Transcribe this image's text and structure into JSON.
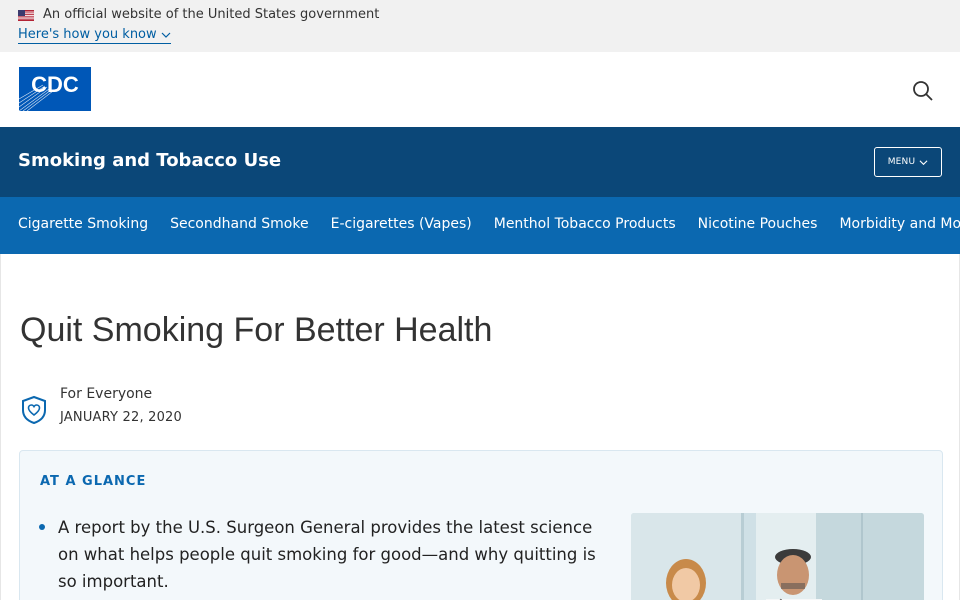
{
  "gov_banner": {
    "official_text": "An official website of the United States government",
    "how_link": "Here's how you know"
  },
  "header": {
    "logo_text": "CDC",
    "search_icon": "search-icon"
  },
  "site_bar": {
    "title": "Smoking and Tobacco Use",
    "menu_label": "MENU"
  },
  "subnav": {
    "items": [
      {
        "label": "Cigarette Smoking"
      },
      {
        "label": "Secondhand Smoke"
      },
      {
        "label": "E-cigarettes (Vapes)"
      },
      {
        "label": "Menthol Tobacco Products"
      },
      {
        "label": "Nicotine Pouches"
      },
      {
        "label": "Morbidity and Mortality"
      }
    ]
  },
  "page": {
    "title": "Quit Smoking For Better Health",
    "audience": "For Everyone",
    "date": "JANUARY 22, 2020"
  },
  "at_a_glance": {
    "heading": "AT A GLANCE",
    "bullets": [
      "A report by the U.S. Surgeon General provides the latest science on what helps people quit smoking for good—and why quitting is so important."
    ]
  },
  "colors": {
    "site_bar": "#0b4778",
    "subnav": "#0b68b0",
    "accent": "#0b68b0",
    "glance_bg": "#f3f8fb"
  }
}
